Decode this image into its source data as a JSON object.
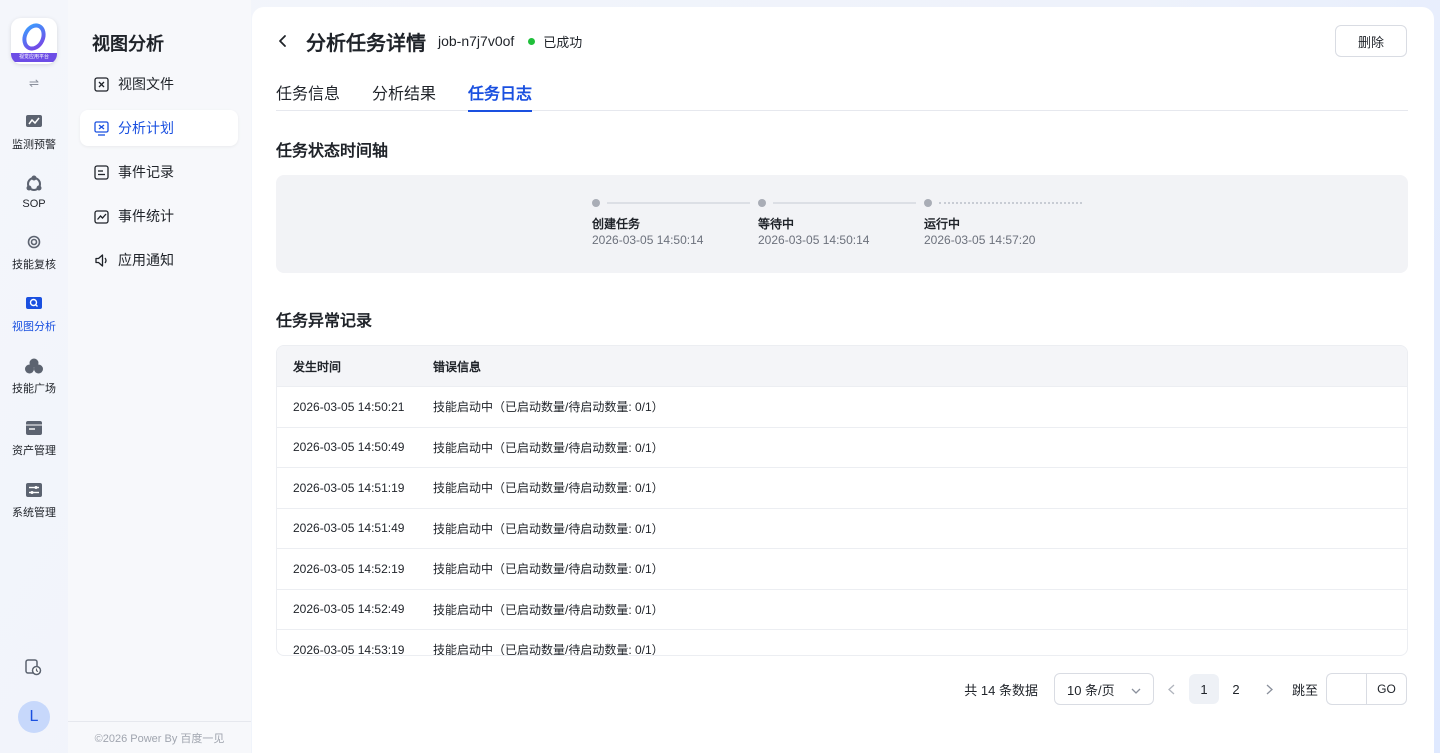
{
  "rail": {
    "logo_text": "视觉应用平台",
    "toggle_icon": "swap-icon",
    "items": [
      {
        "label": "监测预警",
        "icon": "monitor-icon"
      },
      {
        "label": "SOP",
        "icon": "sop-icon"
      },
      {
        "label": "技能复核",
        "icon": "review-icon"
      },
      {
        "label": "视图分析",
        "icon": "view-analysis-icon",
        "active": true
      },
      {
        "label": "技能广场",
        "icon": "skill-plaza-icon"
      },
      {
        "label": "资产管理",
        "icon": "asset-icon"
      },
      {
        "label": "系统管理",
        "icon": "system-icon"
      }
    ],
    "avatar_letter": "L"
  },
  "sidebar": {
    "title": "视图分析",
    "items": [
      {
        "label": "视图文件",
        "icon": "file-icon"
      },
      {
        "label": "分析计划",
        "icon": "plan-icon",
        "active": true
      },
      {
        "label": "事件记录",
        "icon": "record-icon"
      },
      {
        "label": "事件统计",
        "icon": "stats-icon"
      },
      {
        "label": "应用通知",
        "icon": "speaker-icon"
      }
    ],
    "footer": "©2026 Power By 百度一见"
  },
  "header": {
    "title": "分析任务详情",
    "job_id": "job-n7j7v0of",
    "status": "已成功",
    "delete_label": "删除"
  },
  "tabs": [
    {
      "label": "任务信息"
    },
    {
      "label": "分析结果"
    },
    {
      "label": "任务日志",
      "active": true
    }
  ],
  "timeline": {
    "title": "任务状态时间轴",
    "steps": [
      {
        "label": "创建任务",
        "time": "2026-03-05 14:50:14"
      },
      {
        "label": "等待中",
        "time": "2026-03-05 14:50:14"
      },
      {
        "label": "运行中",
        "time": "2026-03-05 14:57:20"
      }
    ]
  },
  "errors": {
    "title": "任务异常记录",
    "columns": [
      "发生时间",
      "错误信息"
    ],
    "rows": [
      {
        "time": "2026-03-05 14:50:21",
        "message": "技能启动中（已启动数量/待启动数量: 0/1）"
      },
      {
        "time": "2026-03-05 14:50:49",
        "message": "技能启动中（已启动数量/待启动数量: 0/1）"
      },
      {
        "time": "2026-03-05 14:51:19",
        "message": "技能启动中（已启动数量/待启动数量: 0/1）"
      },
      {
        "time": "2026-03-05 14:51:49",
        "message": "技能启动中（已启动数量/待启动数量: 0/1）"
      },
      {
        "time": "2026-03-05 14:52:19",
        "message": "技能启动中（已启动数量/待启动数量: 0/1）"
      },
      {
        "time": "2026-03-05 14:52:49",
        "message": "技能启动中（已启动数量/待启动数量: 0/1）"
      },
      {
        "time": "2026-03-05 14:53:19",
        "message": "技能启动中（已启动数量/待启动数量: 0/1）"
      }
    ]
  },
  "pagination": {
    "total": "共 14 条数据",
    "page_size": "10 条/页",
    "pages": [
      "1",
      "2"
    ],
    "current": "1",
    "jump_label": "跳至",
    "go_label": "GO"
  },
  "colors": {
    "accent": "#1a50e0",
    "success": "#1fbf3a"
  }
}
